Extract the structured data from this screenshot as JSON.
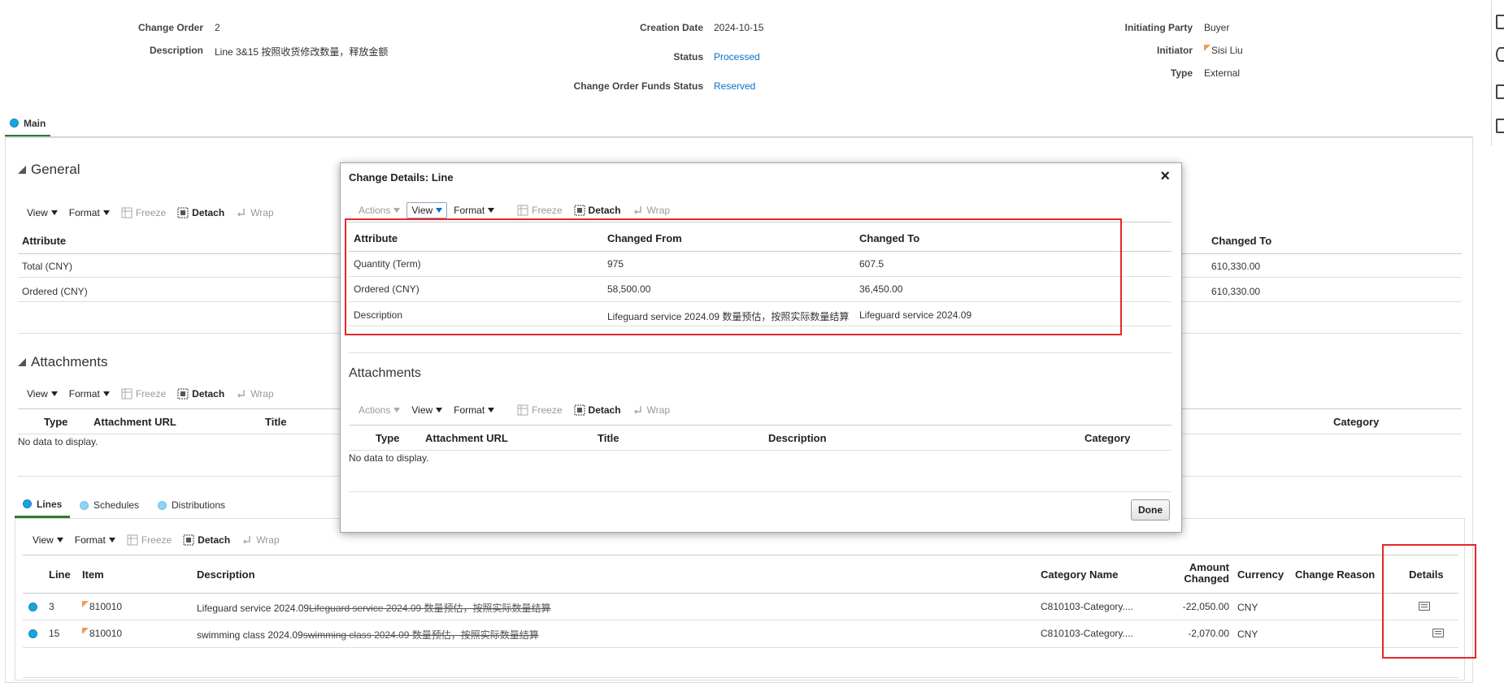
{
  "header": {
    "change_order_label": "Change Order",
    "change_order_value": "2",
    "description_label": "Description",
    "description_value": "Line 3&15 按照收货修改数量，释放金额",
    "creation_date_label": "Creation Date",
    "creation_date_value": "2024-10-15",
    "status_label": "Status",
    "status_value": "Processed",
    "funds_status_label": "Change Order Funds Status",
    "funds_status_value": "Reserved",
    "initiating_party_label": "Initiating Party",
    "initiating_party_value": "Buyer",
    "initiator_label": "Initiator",
    "initiator_value": "Sisi Liu",
    "type_label": "Type",
    "type_value": "External"
  },
  "main_tab": {
    "label": "Main"
  },
  "toolbar": {
    "actions": "Actions",
    "view": "View",
    "format": "Format",
    "freeze": "Freeze",
    "detach": "Detach",
    "wrap": "Wrap"
  },
  "general": {
    "title": "General",
    "columns": {
      "attribute": "Attribute",
      "changed_to": "Changed To"
    },
    "rows": [
      {
        "attribute": "Total (CNY)",
        "changed_to": "610,330.00"
      },
      {
        "attribute": "Ordered (CNY)",
        "changed_to": "610,330.00"
      }
    ]
  },
  "attachments": {
    "title": "Attachments",
    "columns": {
      "type": "Type",
      "url": "Attachment URL",
      "title": "Title",
      "description": "Description",
      "category": "Category"
    },
    "no_data": "No data to display."
  },
  "lines_tabs": {
    "lines": "Lines",
    "schedules": "Schedules",
    "distributions": "Distributions"
  },
  "lines_table": {
    "columns": {
      "line": "Line",
      "item": "Item",
      "description": "Description",
      "category_name": "Category Name",
      "amount_changed_1": "Amount",
      "amount_changed_2": "Changed",
      "currency": "Currency",
      "change_reason": "Change Reason",
      "details": "Details"
    },
    "rows": [
      {
        "line": "3",
        "item": "810010",
        "description_new": "Lifeguard service 2024.09",
        "description_old": "Lifeguard service 2024.09 数量预估，按照实际数量结算",
        "category": "C810103-Category....",
        "amount": "-22,050.00",
        "currency": "CNY"
      },
      {
        "line": "15",
        "item": "810010",
        "description_new": "swimming class 2024.09",
        "description_old": "swimming class 2024.09 数量预估，按照实际数量结算",
        "category": "C810103-Category....",
        "amount": "-2,070.00",
        "currency": "CNY"
      }
    ]
  },
  "dialog": {
    "title": "Change Details: Line",
    "columns": {
      "attribute": "Attribute",
      "changed_from": "Changed From",
      "changed_to": "Changed To"
    },
    "rows": [
      {
        "attribute": "Quantity (Term)",
        "changed_from": "975",
        "changed_to": "607.5"
      },
      {
        "attribute": "Ordered (CNY)",
        "changed_from": "58,500.00",
        "changed_to": "36,450.00"
      },
      {
        "attribute": "Description",
        "changed_from": "Lifeguard service 2024.09 数量预估，按照实际数量结算",
        "changed_to": "Lifeguard service 2024.09"
      }
    ],
    "attachments_title": "Attachments",
    "attachments_columns": {
      "type": "Type",
      "url": "Attachment URL",
      "title": "Title",
      "description": "Description",
      "category": "Category"
    },
    "no_data": "No data to display.",
    "done": "Done"
  },
  "colors": {
    "link": "#0572ce",
    "highlight_red": "#e8262a",
    "tab_underline": "#2f7a2f",
    "dot_blue": "#1ba2e0"
  }
}
